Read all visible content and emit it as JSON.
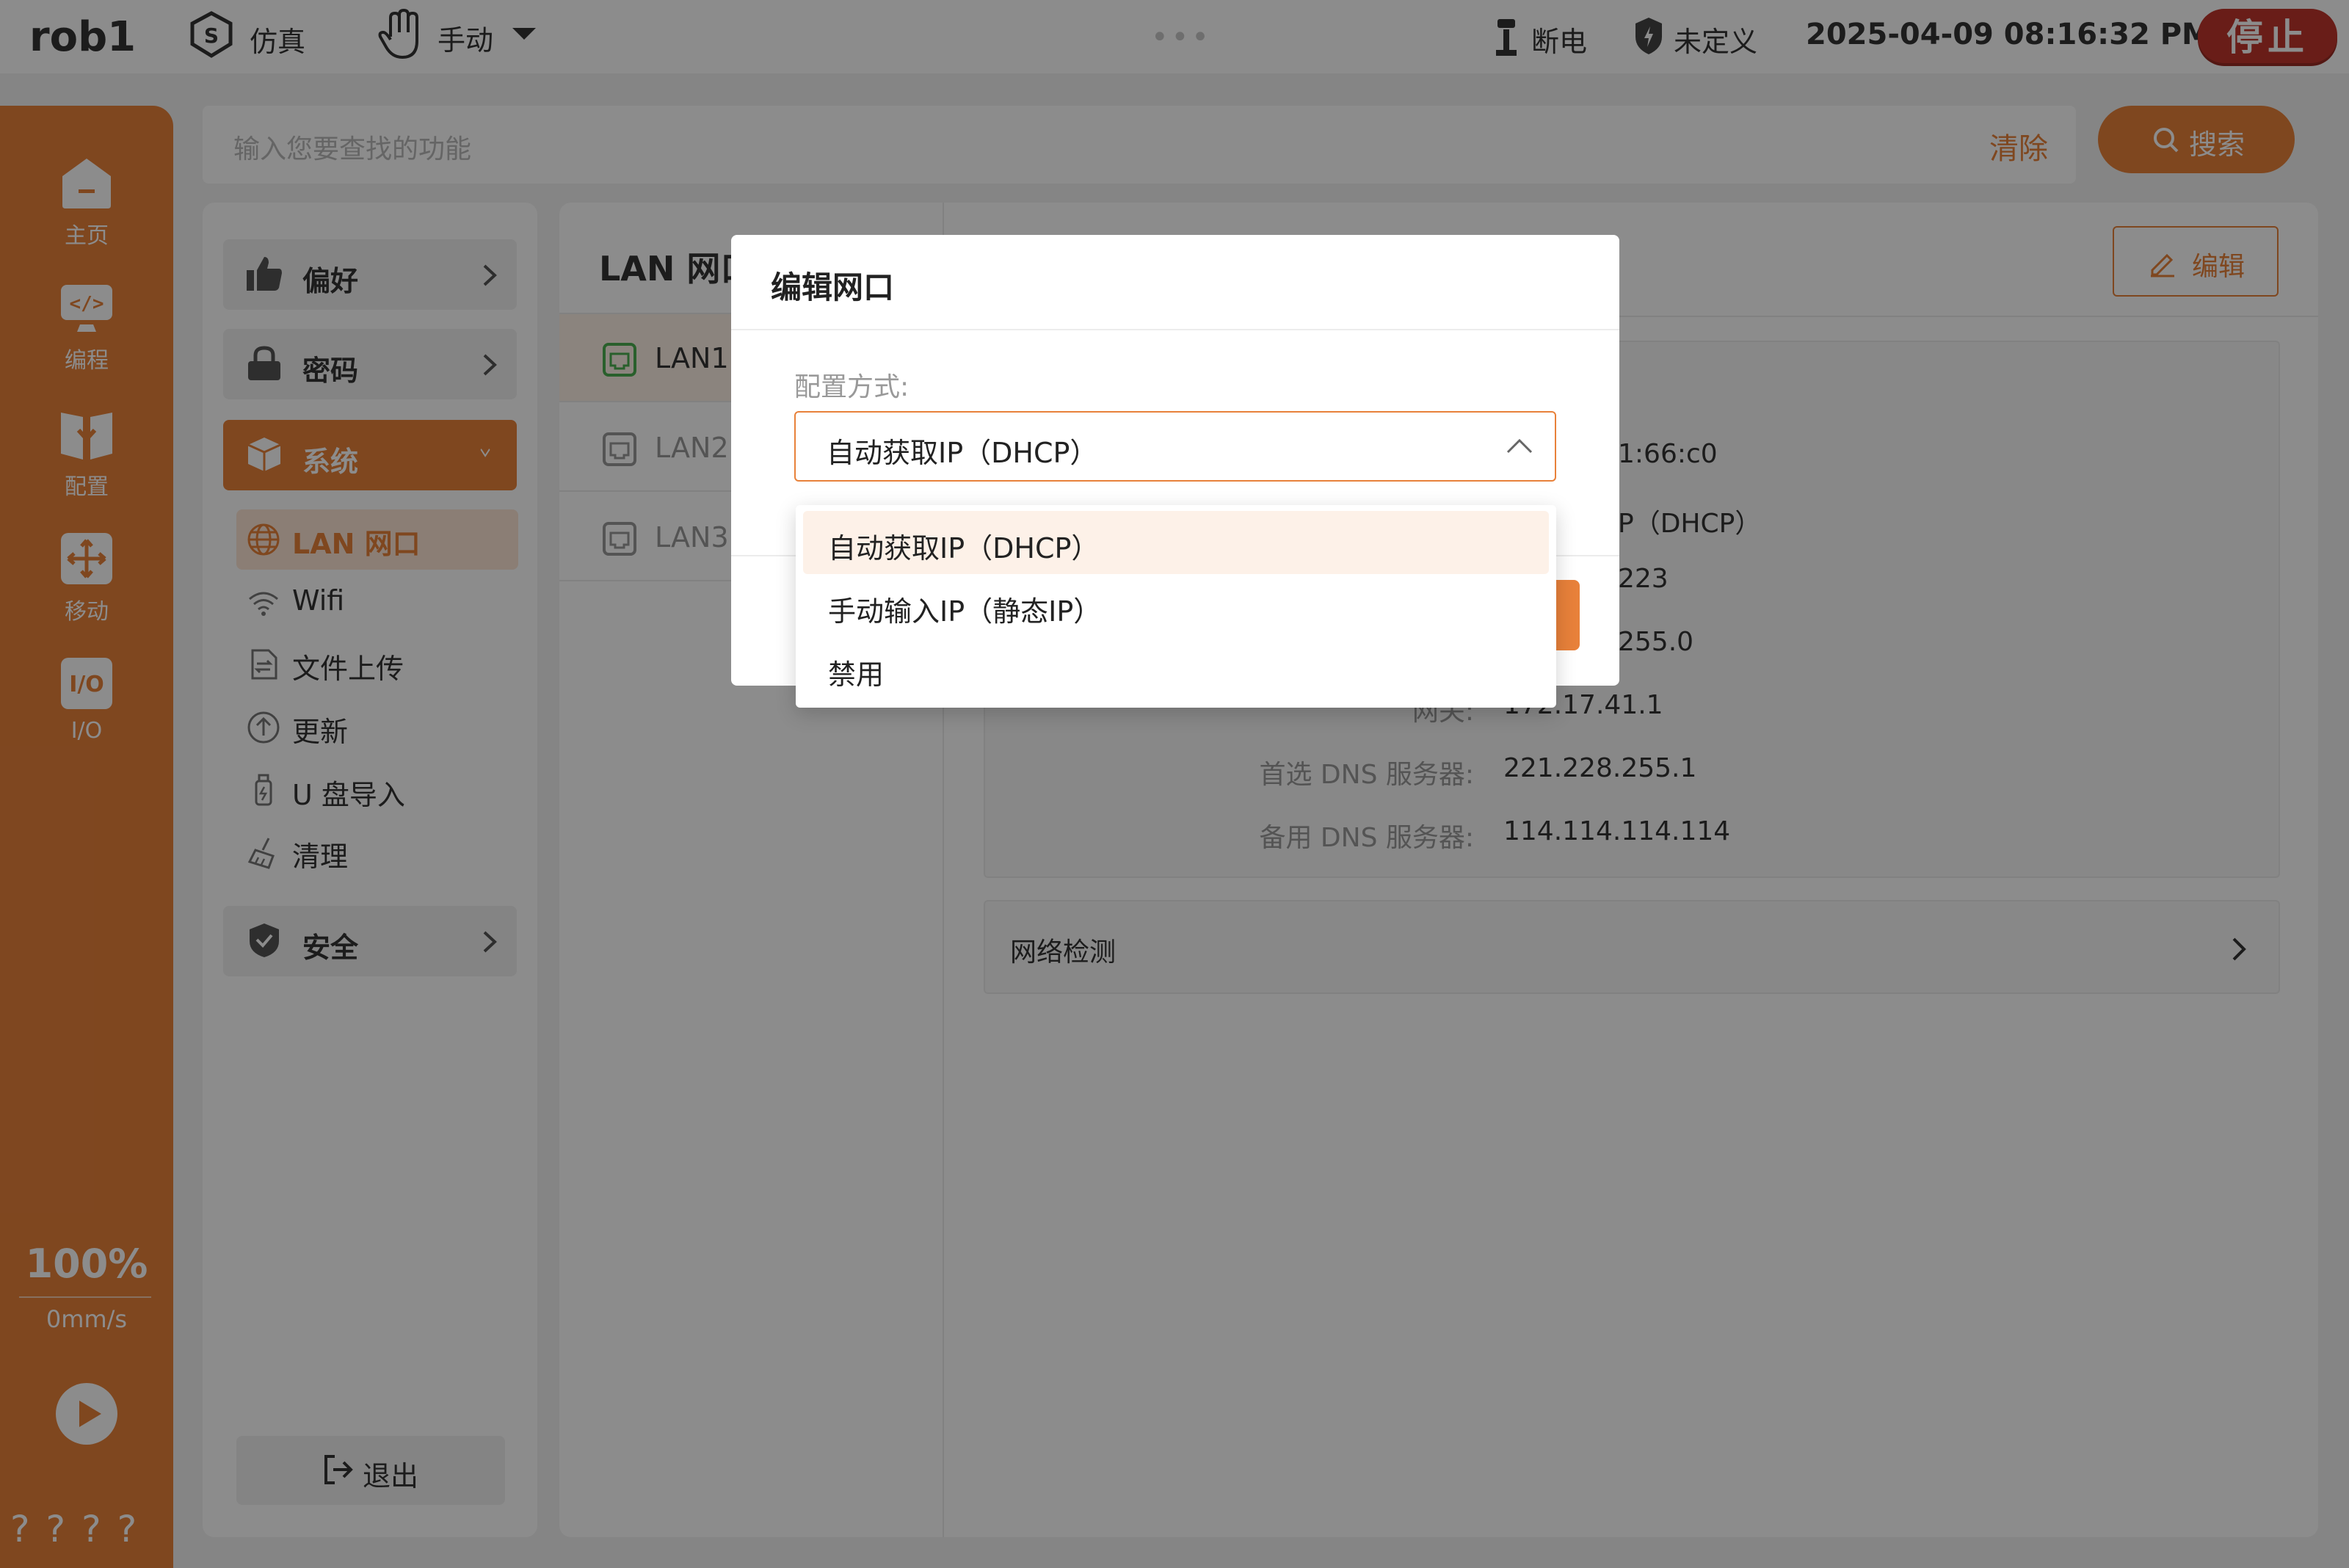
{
  "topbar": {
    "robot_name": "rob1",
    "sim_label": "仿真",
    "mode_label": "手动",
    "dots": "•••",
    "power_label": "断电",
    "safety_label": "未定义",
    "datetime": "2025-04-09 08:16:32 PM",
    "stop_label": "停止"
  },
  "rail": {
    "items": [
      {
        "label": "主页",
        "icon": "home-icon"
      },
      {
        "label": "编程",
        "icon": "code-icon"
      },
      {
        "label": "配置",
        "icon": "download-icon"
      },
      {
        "label": "移动",
        "icon": "move-icon"
      },
      {
        "label": "I/O",
        "icon": "io-icon"
      }
    ],
    "speed_percent": "100%",
    "speed_mms": "0mm/s",
    "help_marks": "????"
  },
  "search": {
    "placeholder": "输入您要查找的功能",
    "clear_label": "清除",
    "button_label": "搜索"
  },
  "settings": {
    "groups": {
      "preferences": "偏好",
      "password": "密码",
      "system": "系统",
      "security": "安全"
    },
    "system_items": [
      {
        "label": "LAN 网口",
        "icon": "globe-icon"
      },
      {
        "label": "Wifi",
        "icon": "wifi-icon"
      },
      {
        "label": "文件上传",
        "icon": "file-transfer-icon"
      },
      {
        "label": "更新",
        "icon": "upload-icon"
      },
      {
        "label": "U 盘导入",
        "icon": "usb-icon"
      },
      {
        "label": "清理",
        "icon": "broom-icon"
      }
    ],
    "logout_label": "退出"
  },
  "lan": {
    "title": "LAN 网口",
    "ports": [
      "LAN1",
      "LAN2",
      "LAN3"
    ],
    "selected_port": "LAN1",
    "edit_label": "编辑",
    "info_visible_fragments": {
      "mac": "1:66:c0",
      "mode": "P（DHCP）",
      "ip": "223",
      "mask": "255.0"
    },
    "gateway_label": "网关:",
    "gateway_value": "172.17.41.1",
    "dns_primary_label": "首选 DNS 服务器:",
    "dns_primary_value": "221.228.255.1",
    "dns_secondary_label": "备用 DNS 服务器:",
    "dns_secondary_value": "114.114.114.114",
    "netcheck_label": "网络检测"
  },
  "modal": {
    "title": "编辑网口",
    "field_label": "配置方式:",
    "selected_value": "自动获取IP（DHCP）",
    "options": [
      "自动获取IP（DHCP）",
      "手动输入IP（静态IP）",
      "禁用"
    ]
  },
  "colors": {
    "accent": "#e8813a",
    "stop": "#c0362c",
    "lan_active_icon": "#4caf50"
  }
}
